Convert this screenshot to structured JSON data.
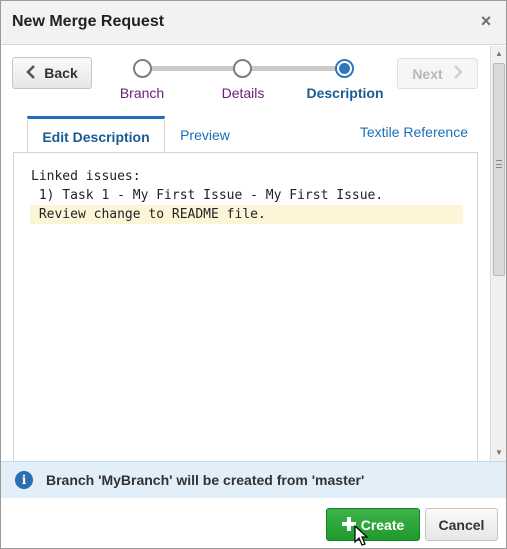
{
  "dialog": {
    "title": "New Merge Request",
    "close_glyph": "×"
  },
  "wizard": {
    "back_label": "Back",
    "next_label": "Next",
    "steps": [
      {
        "label": "Branch",
        "state": "done"
      },
      {
        "label": "Details",
        "state": "done"
      },
      {
        "label": "Description",
        "state": "active"
      }
    ]
  },
  "tabs": {
    "edit_label": "Edit Description",
    "preview_label": "Preview",
    "reference_link": "Textile Reference"
  },
  "editor": {
    "lines": [
      "Linked issues:",
      " 1) Task 1 - My First Issue - My First Issue.",
      " Review change to README file."
    ]
  },
  "info": {
    "icon": "info-icon",
    "message": "Branch 'MyBranch' will be created from 'master'"
  },
  "footer": {
    "create_label": "Create",
    "cancel_label": "Cancel"
  },
  "colors": {
    "accent": "#2f77b9",
    "create_green": "#1f9a2c",
    "highlight": "#fdf5d8",
    "info_bg": "#e2eef8"
  }
}
